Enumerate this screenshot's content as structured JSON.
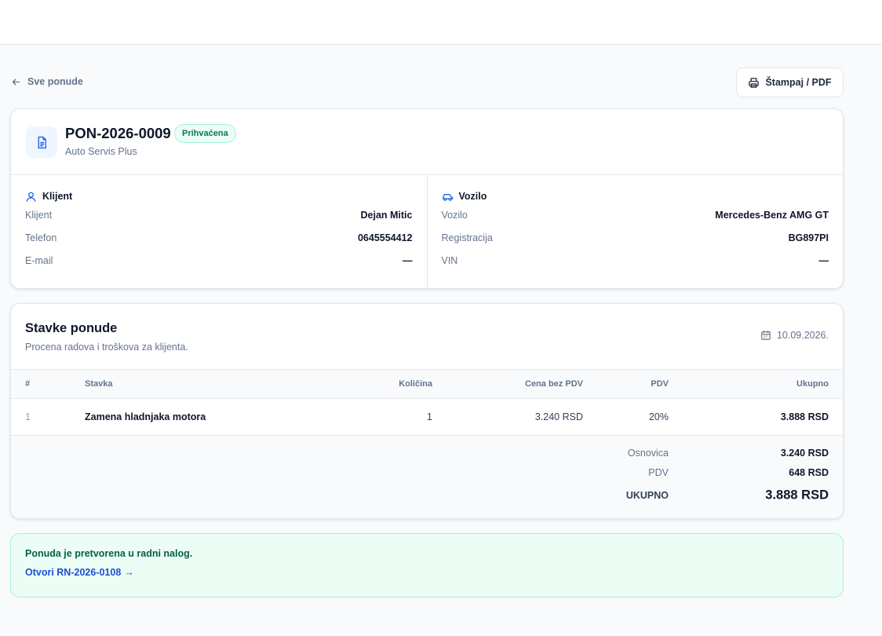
{
  "nav": {
    "back_label": "Sve ponude",
    "print_label": "Štampaj / PDF"
  },
  "quote": {
    "number": "PON-2026-0009",
    "status": "Prihvaćena",
    "company": "Auto Servis Plus"
  },
  "client": {
    "title": "Klijent",
    "rows": [
      {
        "label": "Klijent",
        "value": "Dejan Mitic"
      },
      {
        "label": "Telefon",
        "value": "0645554412"
      },
      {
        "label": "E-mail",
        "value": "—"
      }
    ]
  },
  "vehicle": {
    "title": "Vozilo",
    "rows": [
      {
        "label": "Vozilo",
        "value": "Mercedes-Benz AMG GT"
      },
      {
        "label": "Registracija",
        "value": "BG897PI"
      },
      {
        "label": "VIN",
        "value": "—"
      }
    ]
  },
  "items": {
    "title": "Stavke ponude",
    "subtitle": "Procena radova i troškova za klijenta.",
    "date": "10.09.2026.",
    "columns": {
      "num": "#",
      "item": "Stavka",
      "qty": "Količina",
      "price": "Cena bez PDV",
      "vat": "PDV",
      "total": "Ukupno"
    },
    "rows": [
      {
        "num": "1",
        "item": "Zamena hladnjaka motora",
        "qty": "1",
        "price": "3.240 RSD",
        "vat": "20%",
        "total": "3.888 RSD"
      }
    ],
    "totals": {
      "base_label": "Osnovica",
      "base_value": "3.240 RSD",
      "vat_label": "PDV",
      "vat_value": "648 RSD",
      "grand_label": "UKUPNO",
      "grand_value": "3.888 RSD"
    }
  },
  "notice": {
    "text": "Ponuda je pretvorena u radni nalog.",
    "link": "Otvori RN-2026-0108",
    "arrow": "→"
  },
  "colors": {
    "accent": "#1d4ed8",
    "success_bg": "#ecfdf5",
    "success_border": "#a7f3d0",
    "success_text": "#065f46"
  }
}
